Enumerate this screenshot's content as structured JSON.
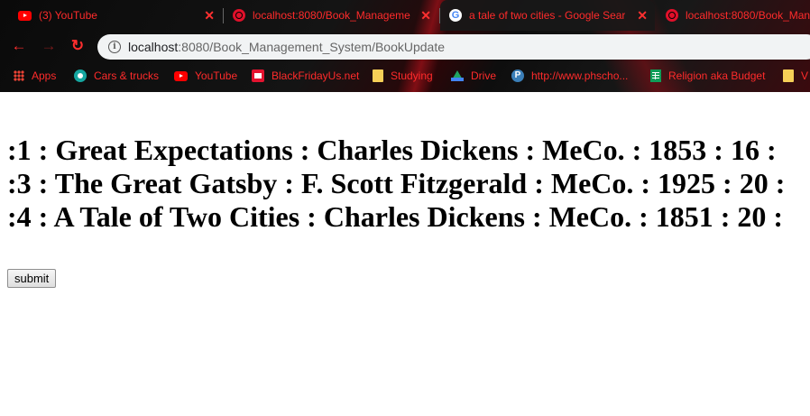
{
  "tabs": [
    {
      "title": "(3) YouTube",
      "favicon": "youtube-icon"
    },
    {
      "title": "localhost:8080/Book_Manageme",
      "favicon": "globe-icon"
    },
    {
      "title": "a tale of two cities - Google Sear",
      "favicon": "google-icon"
    },
    {
      "title": "localhost:8080/Book_Man",
      "favicon": "globe-icon"
    }
  ],
  "toolbar": {
    "back_glyph": "←",
    "forward_glyph": "→",
    "reload_glyph": "↻",
    "url_host": "localhost",
    "url_rest": ":8080/Book_Management_System/BookUpdate"
  },
  "bookmarks": [
    {
      "label": "Apps",
      "icon": "apps-grid-icon"
    },
    {
      "label": "Cars & trucks",
      "icon": "cars-icon"
    },
    {
      "label": "YouTube",
      "icon": "youtube-icon"
    },
    {
      "label": "BlackFridayUs.net",
      "icon": "blackfriday-icon"
    },
    {
      "label": "Studying",
      "icon": "folder-icon"
    },
    {
      "label": "Drive",
      "icon": "drive-icon"
    },
    {
      "label": "http://www.phscho...",
      "icon": "p-icon"
    },
    {
      "label": "Religion aka Budget",
      "icon": "sheets-icon"
    },
    {
      "label": "V",
      "icon": "folder-icon"
    }
  ],
  "books": [
    ":1 : Great Expectations : Charles Dickens : MeCo. : 1853 : 16 :",
    ":3 : The Great Gatsby : F. Scott Fitzgerald : MeCo. : 1925 : 20 :",
    ":4 : A Tale of Two Cities : Charles Dickens : MeCo. : 1851 : 20 :"
  ],
  "form": {
    "submit_label": "submit"
  },
  "colors": {
    "accent": "#ff2b2b",
    "page_background": "#ffffff",
    "text": "#000000"
  }
}
